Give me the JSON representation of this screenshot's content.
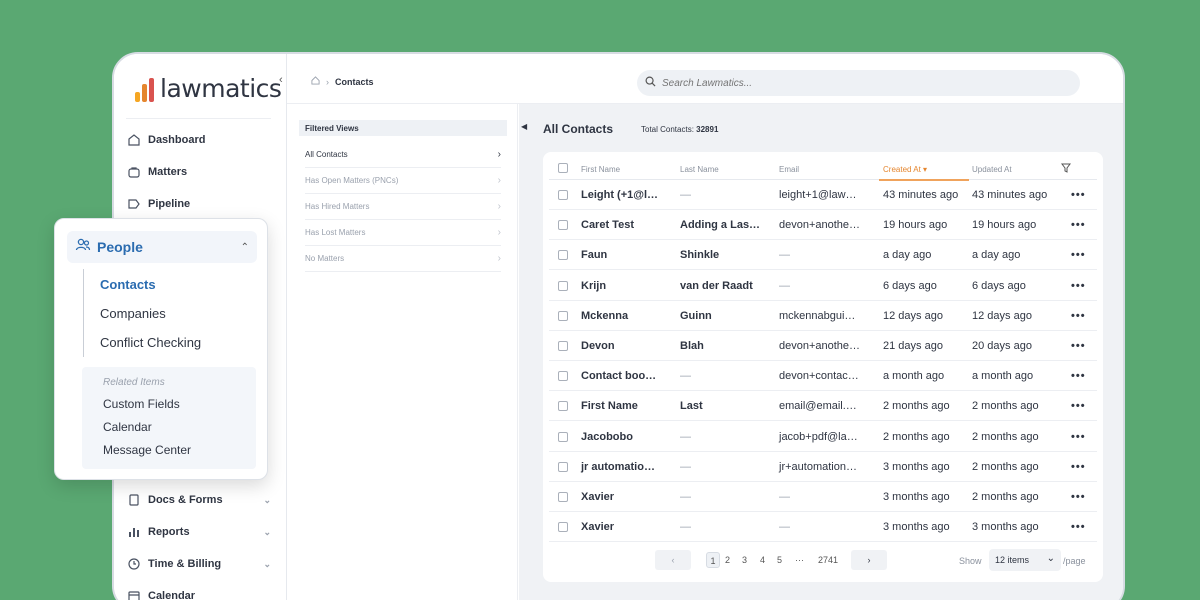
{
  "brand": {
    "name": "lawmatics",
    "bar_colors": [
      "#f5a623",
      "#e5862f",
      "#d9534f"
    ]
  },
  "sidebar": {
    "items_top": [
      {
        "label": "Dashboard",
        "icon": "home-icon"
      },
      {
        "label": "Matters",
        "icon": "briefcase-icon"
      },
      {
        "label": "Pipeline",
        "icon": "pipeline-icon"
      }
    ],
    "items_bottom": [
      {
        "label": "Docs & Forms",
        "icon": "document-icon"
      },
      {
        "label": "Reports",
        "icon": "bar-chart-icon"
      },
      {
        "label": "Time & Billing",
        "icon": "clock-icon"
      },
      {
        "label": "Calendar",
        "icon": "calendar-icon"
      }
    ]
  },
  "popup": {
    "title": "People",
    "links": [
      "Contacts",
      "Companies",
      "Conflict Checking"
    ],
    "related_heading": "Related Items",
    "related": [
      "Custom Fields",
      "Calendar",
      "Message Center"
    ]
  },
  "breadcrumb": {
    "current": "Contacts"
  },
  "search": {
    "placeholder": "Search Lawmatics..."
  },
  "views": {
    "heading": "Filtered Views",
    "items": [
      "All Contacts",
      "Has Open Matters (PNCs)",
      "Has Hired Matters",
      "Has Lost Matters",
      "No Matters"
    ]
  },
  "main": {
    "title": "All Contacts",
    "total_label": "Total Contacts:",
    "total_value": "32891"
  },
  "table": {
    "headers": [
      "First Name",
      "Last Name",
      "Email",
      "Created At ▾",
      "Updated At"
    ],
    "rows": [
      {
        "first": "Leight (+1@l…",
        "last": "—",
        "email": "leight+1@law…",
        "created": "43 minutes ago",
        "updated": "43 minutes ago"
      },
      {
        "first": "Caret Test",
        "last": "Adding a Las…",
        "email": "devon+anothe…",
        "created": "19 hours ago",
        "updated": "19 hours ago"
      },
      {
        "first": "Faun",
        "last": "Shinkle",
        "email": "—",
        "created": "a day ago",
        "updated": "a day ago"
      },
      {
        "first": "Krijn",
        "last": "van der Raadt",
        "email": "—",
        "created": "6 days ago",
        "updated": "6 days ago"
      },
      {
        "first": "Mckenna",
        "last": "Guinn",
        "email": "mckennabgui…",
        "created": "12 days ago",
        "updated": "12 days ago"
      },
      {
        "first": "Devon",
        "last": "Blah",
        "email": "devon+anothe…",
        "created": "21 days ago",
        "updated": "20 days ago"
      },
      {
        "first": "Contact boo…",
        "last": "—",
        "email": "devon+contac…",
        "created": "a month ago",
        "updated": "a month ago"
      },
      {
        "first": "First Name",
        "last": "Last",
        "email": "email@email.…",
        "created": "2 months ago",
        "updated": "2 months ago"
      },
      {
        "first": "Jacobobo",
        "last": "—",
        "email": "jacob+pdf@la…",
        "created": "2 months ago",
        "updated": "2 months ago"
      },
      {
        "first": "jr automatio…",
        "last": "—",
        "email": "jr+automation…",
        "created": "3 months ago",
        "updated": "2 months ago"
      },
      {
        "first": "Xavier",
        "last": "—",
        "email": "—",
        "created": "3 months ago",
        "updated": "2 months ago"
      },
      {
        "first": "Xavier",
        "last": "—",
        "email": "—",
        "created": "3 months ago",
        "updated": "3 months ago"
      }
    ],
    "more_label": "•••"
  },
  "pagination": {
    "pages": [
      "1",
      "2",
      "3",
      "4",
      "5",
      "···",
      "2741"
    ],
    "show_label": "Show",
    "page_size": "12 items",
    "per_label": "/page"
  }
}
